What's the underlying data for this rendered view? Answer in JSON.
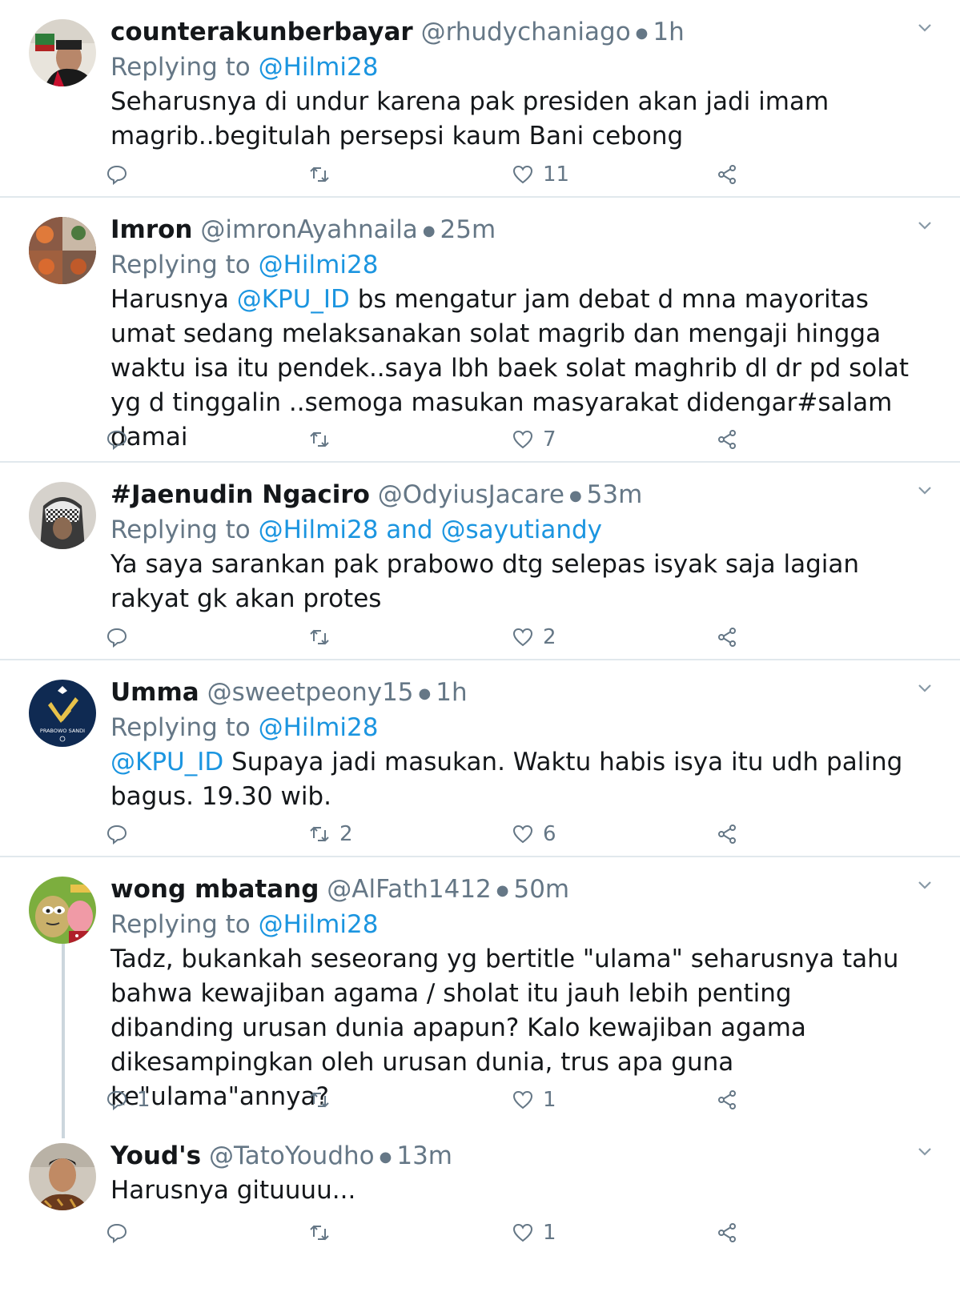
{
  "tweets": [
    {
      "name": "counterakunberbayar",
      "handle": "@rhudychaniago",
      "time": "1h",
      "replying_prefix": "Replying to ",
      "replying_to": "@Hilmi28",
      "replying_to_2": "",
      "body_prefix": "",
      "body": "Seharusnya di undur karena pak presiden akan jadi imam magrib..begitulah persepsi kaum Bani cebong",
      "replies": "",
      "retweets": "",
      "likes": "11",
      "avatar_icon": "photo-avatar-icon"
    },
    {
      "name": "Imron",
      "handle": "@imronAyahnaila",
      "time": "25m",
      "replying_prefix": "Replying to ",
      "replying_to": "@Hilmi28",
      "replying_to_2": "",
      "body_prefix": "Harusnya ",
      "body_mention": "@KPU_ID",
      "body": " bs mengatur jam debat d mna mayoritas umat sedang melaksanakan solat magrib dan mengaji hingga waktu isa itu pendek..saya lbh baek solat maghrib dl dr pd solat yg d tinggalin ..semoga masukan masyarakat didengar#salam damai",
      "replies": "",
      "retweets": "",
      "likes": "7",
      "avatar_icon": "photo-avatar-icon"
    },
    {
      "name": "#Jaenudin Ngaciro",
      "handle": "@OdyiusJacare",
      "time": "53m",
      "replying_prefix": "Replying to ",
      "replying_to": "@Hilmi28",
      "replying_and": " and ",
      "replying_to_2": "@sayutiandy",
      "body_prefix": "",
      "body": "Ya saya sarankan pak prabowo dtg selepas isyak saja lagian rakyat gk akan protes",
      "replies": "",
      "retweets": "",
      "likes": "2",
      "avatar_icon": "photo-avatar-icon"
    },
    {
      "name": "Umma",
      "handle": "@sweetpeony15",
      "time": "1h",
      "replying_prefix": "Replying to ",
      "replying_to": "@Hilmi28",
      "replying_to_2": "",
      "body_prefix": "",
      "body_mention": "@KPU_ID",
      "body": " Supaya jadi masukan. Waktu habis isya itu udh paling bagus. 19.30 wib.",
      "replies": "",
      "retweets": "2",
      "likes": "6",
      "avatar_text": "PRABOWO SANDI",
      "avatar_icon": "prabowo-sandi-logo-icon"
    },
    {
      "name": "wong mbatang",
      "handle": "@AlFath1412",
      "time": "50m",
      "replying_prefix": "Replying to ",
      "replying_to": "@Hilmi28",
      "replying_to_2": "",
      "body_prefix": "",
      "body": "Tadz, bukankah seseorang yg bertitle \"ulama\" seharusnya tahu bahwa kewajiban agama / sholat itu jauh lebih penting dibanding urusan dunia apapun? Kalo kewajiban agama dikesampingkan oleh urusan dunia, trus apa guna ke\"ulama\"annya?",
      "replies": "1",
      "retweets": "",
      "likes": "1",
      "avatar_icon": "cartoon-avatar-icon"
    },
    {
      "name": "Youd's",
      "handle": "@TatoYoudho",
      "time": "13m",
      "body_prefix": "",
      "body": "Harusnya gituuuu...",
      "replies": "",
      "retweets": "",
      "likes": "1",
      "avatar_icon": "photo-avatar-icon"
    }
  ],
  "colors": {
    "text": "#14171a",
    "muted": "#657786",
    "link": "#1b95e0",
    "divider": "#e1e8ed"
  }
}
